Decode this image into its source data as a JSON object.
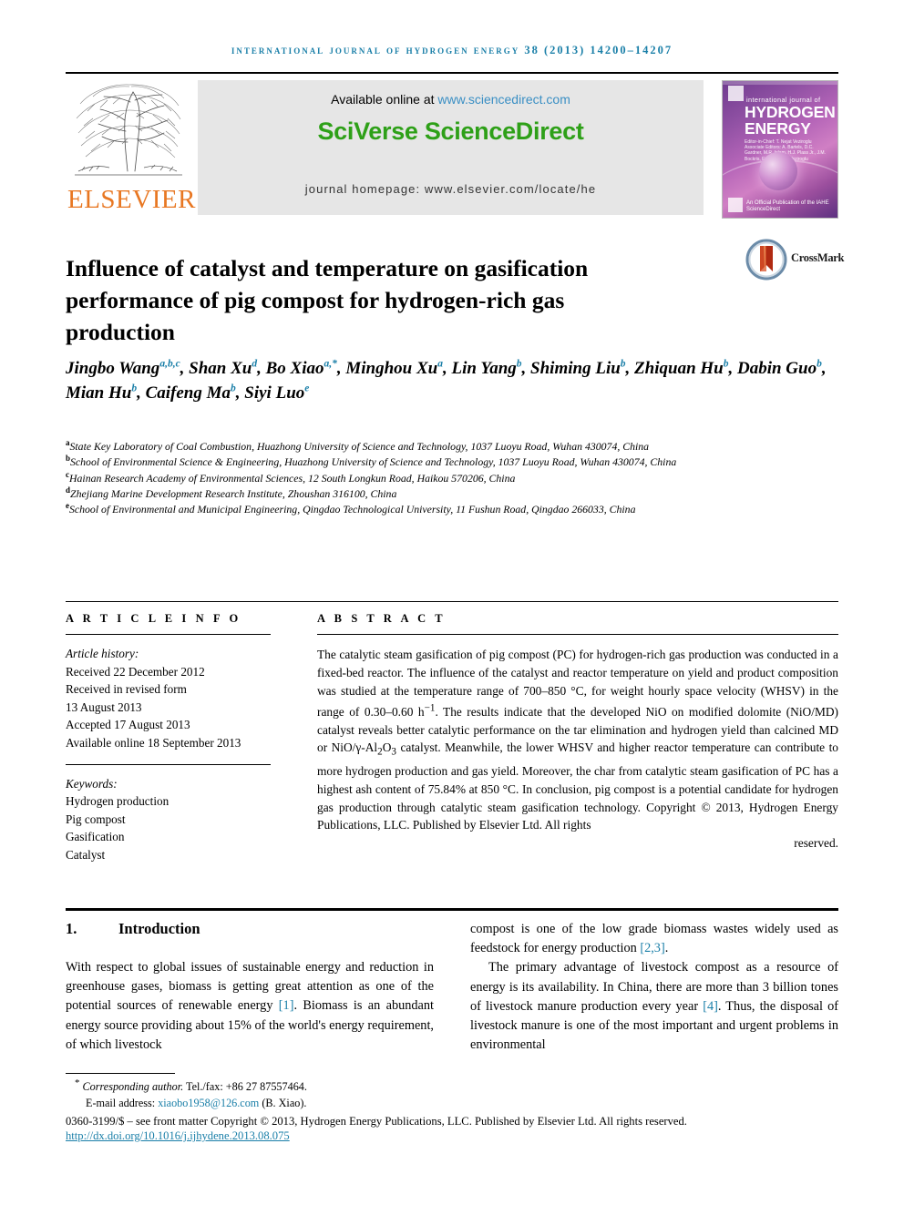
{
  "running_head": "International Journal of Hydrogen Energy 38 (2013) 14200–14207",
  "masthead": {
    "available_prefix": "Available online at ",
    "sciencedirect_url": "www.sciencedirect.com",
    "brand": "SciVerse ScienceDirect",
    "homepage": "journal homepage: www.elsevier.com/locate/he",
    "publisher": "ELSEVIER",
    "cover": {
      "small_line": "international journal of",
      "title_line1": "HYDROGEN",
      "title_line2": "ENERGY",
      "editors": "Editor-in-Chief: T. Nejat Veziroglu   Associate Editors: A. Bartels, D.C. Gardner, M.R. Islam, H.J. Plass Jr., J.M. Bockris, E. Tzimas, T. Veziroglu",
      "sciencedirect_mark": "An Official Publication of the IAHE  ScienceDirect"
    }
  },
  "article": {
    "title": "Influence of catalyst and temperature on gasification performance of pig compost for hydrogen-rich gas production",
    "crossmark_label": "CrossMark",
    "authors_html": "Jingbo Wang<sup>a,b,c</sup>, Shan Xu<sup>d</sup>, Bo Xiao<sup>a,*</sup>, Minghou Xu<sup>a</sup>, Lin Yang<sup>b</sup>, Shiming Liu<sup>b</sup>, Zhiquan Hu<sup>b</sup>, Dabin Guo<sup>b</sup>, Mian Hu<sup>b</sup>, Caifeng Ma<sup>b</sup>, Siyi Luo<sup>e</sup>",
    "affiliations": [
      {
        "marker": "a",
        "text": "State Key Laboratory of Coal Combustion, Huazhong University of Science and Technology, 1037 Luoyu Road, Wuhan 430074, China"
      },
      {
        "marker": "b",
        "text": "School of Environmental Science & Engineering, Huazhong University of Science and Technology, 1037 Luoyu Road, Wuhan 430074, China"
      },
      {
        "marker": "c",
        "text": "Hainan Research Academy of Environmental Sciences, 12 South Longkun Road, Haikou 570206, China"
      },
      {
        "marker": "d",
        "text": "Zhejiang Marine Development Research Institute, Zhoushan 316100, China"
      },
      {
        "marker": "e",
        "text": "School of Environmental and Municipal Engineering, Qingdao Technological University, 11 Fushun Road, Qingdao 266033, China"
      }
    ]
  },
  "article_info": {
    "heading": "A R T I C L E   I N F O",
    "history_label": "Article history:",
    "history": [
      "Received 22 December 2012",
      "Received in revised form",
      "13 August 2013",
      "Accepted 17 August 2013",
      "Available online 18 September 2013"
    ],
    "keywords_label": "Keywords:",
    "keywords": [
      "Hydrogen production",
      "Pig compost",
      "Gasification",
      "Catalyst"
    ]
  },
  "abstract": {
    "heading": "A B S T R A C T",
    "body_html": "The catalytic steam gasification of pig compost (PC) for hydrogen-rich gas production was conducted in a fixed-bed reactor. The influence of the catalyst and reactor temperature on yield and product composition was studied at the temperature range of 700–850 °C, for weight hourly space velocity (WHSV) in the range of 0.30–0.60 h<sup>−1</sup>. The results indicate that the developed NiO on modified dolomite (NiO/MD) catalyst reveals better catalytic performance on the tar elimination and hydrogen yield than calcined MD or NiO/&gamma;-Al<sub>2</sub>O<sub>3</sub> catalyst. Meanwhile, the lower WHSV and higher reactor temperature can contribute to more hydrogen production and gas yield. Moreover, the char from catalytic steam gasification of PC has a highest ash content of 75.84% at 850 °C. In conclusion, pig compost is a potential candidate for hydrogen gas production through catalytic steam gasification technology.",
    "copyright_html": "Copyright &copy; 2013, Hydrogen Energy Publications, LLC. Published by Elsevier Ltd. All rights",
    "copyright_tail": "reserved."
  },
  "body": {
    "section_number": "1.",
    "section_title": "Introduction",
    "left_html": "With respect to global issues of sustainable energy and reduction in greenhouse gases, biomass is getting great attention as one of the potential sources of renewable energy <span class=\"ref\">[1]</span>. Biomass is an abundant energy source providing about 15% of the world's energy requirement, of which livestock",
    "right_p1_html": "compost is one of the low grade biomass wastes widely used as feedstock for energy production <span class=\"ref\">[2,3]</span>.",
    "right_p2_html": "The primary advantage of livestock compost as a resource of energy is its availability. In China, there are more than 3 billion tones of livestock manure production every year <span class=\"ref\">[4]</span>. Thus, the disposal of livestock manure is one of the most important and urgent problems in environmental"
  },
  "footer": {
    "corresponding_html": "<span class=\"star\">*</span> <i>Corresponding author.</i> Tel./fax: +86 27 87557464.",
    "email_label": "E-mail address: ",
    "email": "xiaobo1958@126.com",
    "email_suffix": " (B. Xiao).",
    "copyright_html": "0360-3199/$ – see front matter Copyright &copy; 2013, Hydrogen Energy Publications, LLC. Published by Elsevier Ltd. All rights reserved.",
    "doi": "http://dx.doi.org/10.1016/j.ijhydene.2013.08.075"
  },
  "colors": {
    "link": "#1a7fa8",
    "sciencedirect_green": "#2ea018",
    "elsevier_orange": "#e87722",
    "sd_link_blue": "#3a8fc4"
  }
}
